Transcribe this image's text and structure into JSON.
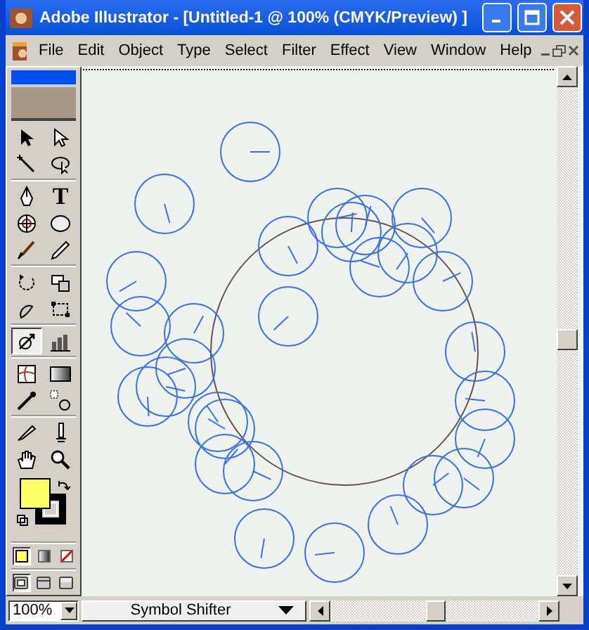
{
  "window": {
    "title": "Adobe Illustrator - [Untitled-1 @ 100% (CMYK/Preview) ]"
  },
  "menu": [
    "File",
    "Edit",
    "Object",
    "Type",
    "Select",
    "Filter",
    "Effect",
    "View",
    "Window",
    "Help"
  ],
  "toolbox": {
    "tools": [
      {
        "kind": "select",
        "selected": false
      },
      {
        "kind": "direct-select",
        "selected": false
      },
      {
        "kind": "wand",
        "selected": false
      },
      {
        "kind": "lasso",
        "selected": false
      },
      {
        "kind": "pen",
        "selected": false
      },
      {
        "kind": "type",
        "label": "T",
        "selected": false
      },
      {
        "kind": "polar-grid",
        "selected": false
      },
      {
        "kind": "ellipse",
        "selected": false
      },
      {
        "kind": "brush",
        "selected": false
      },
      {
        "kind": "pencil",
        "selected": false
      },
      {
        "kind": "rotate",
        "selected": false
      },
      {
        "kind": "scale",
        "selected": false
      },
      {
        "kind": "warp",
        "selected": false
      },
      {
        "kind": "free-transform",
        "selected": false
      },
      {
        "kind": "symbol-shifter",
        "selected": true
      },
      {
        "kind": "graph",
        "selected": false
      },
      {
        "kind": "mesh",
        "selected": false
      },
      {
        "kind": "gradient",
        "selected": false
      },
      {
        "kind": "eyedropper",
        "selected": false
      },
      {
        "kind": "blend",
        "selected": false
      },
      {
        "kind": "knife",
        "selected": false
      },
      {
        "kind": "slice",
        "selected": false
      },
      {
        "kind": "hand",
        "selected": false
      },
      {
        "kind": "zoom",
        "selected": false
      }
    ],
    "colors": [
      {
        "kind": "fill",
        "color": "#ffff66"
      },
      {
        "kind": "stroke",
        "color": "#000000"
      }
    ],
    "paint_modes": [
      {
        "kind": "color",
        "selected": true
      },
      {
        "kind": "gradient",
        "selected": false
      },
      {
        "kind": "none",
        "selected": false
      }
    ],
    "screen_modes": [
      {
        "kind": "standard",
        "selected": true
      },
      {
        "kind": "full-menu",
        "selected": false
      },
      {
        "kind": "full",
        "selected": false
      }
    ]
  },
  "status_bar": {
    "zoom": "100%",
    "tool_name": "Symbol Shifter"
  }
}
